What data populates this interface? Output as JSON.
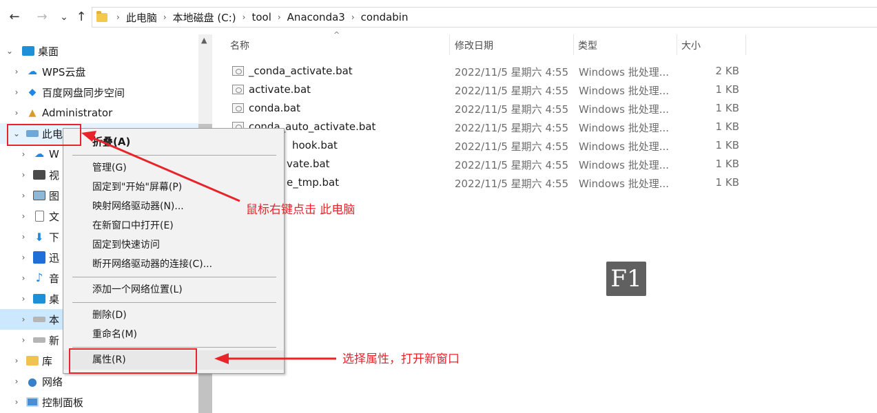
{
  "nav_buttons": {
    "back": "←",
    "forward": "→",
    "recent": "⌄",
    "up": "↑"
  },
  "breadcrumb": [
    "此电脑",
    "本地磁盘 (C:)",
    "tool",
    "Anaconda3",
    "condabin"
  ],
  "tree": [
    {
      "label": "桌面",
      "icon": "desktop-icon",
      "chev": "⌄"
    },
    {
      "label": "WPS云盘",
      "icon": "cloud-icon",
      "chev": "›"
    },
    {
      "label": "百度网盘同步空间",
      "icon": "baidu-sync-icon",
      "chev": "›"
    },
    {
      "label": "Administrator",
      "icon": "user-icon",
      "chev": "›"
    },
    {
      "label": "此电",
      "icon": "computer-icon",
      "chev": "⌄"
    },
    {
      "label": "W",
      "icon": "cloud-icon",
      "chev": "›"
    },
    {
      "label": "视",
      "icon": "video-icon",
      "chev": "›"
    },
    {
      "label": "图",
      "icon": "picture-icon",
      "chev": "›"
    },
    {
      "label": "文",
      "icon": "document-icon",
      "chev": "›"
    },
    {
      "label": "下",
      "icon": "download-icon",
      "chev": "›"
    },
    {
      "label": "迅",
      "icon": "xunlei-icon",
      "chev": "›"
    },
    {
      "label": "音",
      "icon": "music-icon",
      "chev": "›"
    },
    {
      "label": "桌",
      "icon": "desktop-icon",
      "chev": "›"
    },
    {
      "label": "本",
      "icon": "drive-icon",
      "chev": "›"
    },
    {
      "label": "新",
      "icon": "drive-icon",
      "chev": "›"
    },
    {
      "label": "库",
      "icon": "library-icon",
      "chev": "›"
    },
    {
      "label": "网络",
      "icon": "network-icon",
      "chev": "›"
    },
    {
      "label": "控制面板",
      "icon": "control-panel-icon",
      "chev": "›"
    }
  ],
  "columns": {
    "name": "名称",
    "date": "修改日期",
    "type": "类型",
    "size": "大小"
  },
  "files": [
    {
      "name": "_conda_activate.bat",
      "date": "2022/11/5 星期六 4:55",
      "type": "Windows 批处理...",
      "size": "2 KB"
    },
    {
      "name": "activate.bat",
      "date": "2022/11/5 星期六 4:55",
      "type": "Windows 批处理...",
      "size": "1 KB"
    },
    {
      "name": "conda.bat",
      "date": "2022/11/5 星期六 4:55",
      "type": "Windows 批处理...",
      "size": "1 KB"
    },
    {
      "name": "conda_auto_activate.bat",
      "date": "2022/11/5 星期六 4:55",
      "type": "Windows 批处理...",
      "size": "1 KB"
    },
    {
      "name": "hook.bat",
      "date": "2022/11/5 星期六 4:55",
      "type": "Windows 批处理...",
      "size": "1 KB"
    },
    {
      "name": "vate.bat",
      "date": "2022/11/5 星期六 4:55",
      "type": "Windows 批处理...",
      "size": "1 KB"
    },
    {
      "name": "e_tmp.bat",
      "date": "2022/11/5 星期六 4:55",
      "type": "Windows 批处理...",
      "size": "1 KB"
    }
  ],
  "context_menu": {
    "collapse": "折叠(A)",
    "manage": "管理(G)",
    "pin_start": "固定到\"开始\"屏幕(P)",
    "map_drive": "映射网络驱动器(N)...",
    "open_new_window": "在新窗口中打开(E)",
    "pin_quick": "固定到快速访问",
    "disconnect": "断开网络驱动器的连接(C)...",
    "add_network": "添加一个网络位置(L)",
    "delete": "删除(D)",
    "rename": "重命名(M)",
    "properties": "属性(R)"
  },
  "annotations": {
    "right_click": "鼠标右键点击 此电脑",
    "choose_properties": "选择属性，打开新窗口",
    "badge": "F1"
  },
  "colors": {
    "selection": "#cce8ff",
    "hover": "#e5f3ff",
    "annotation_red": "#e8232a",
    "badge_bg": "#606060"
  }
}
